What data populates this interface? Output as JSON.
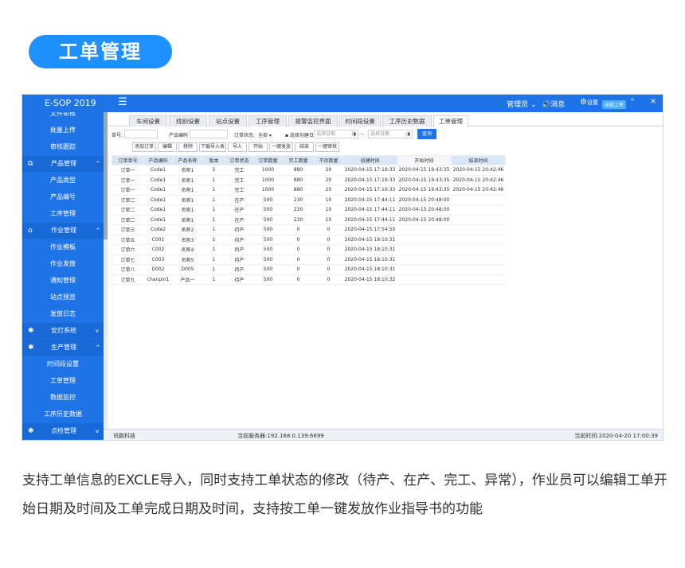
{
  "banner": {
    "title": "工单管理"
  },
  "topbar": {
    "brand": "E-SOP 2019",
    "menu_icon": "menu-icon",
    "user": "管理员",
    "messages": "消息",
    "settings": "设置",
    "badge": "当前上件",
    "minimize": "ᵒ",
    "close": "×"
  },
  "sidebar": {
    "items": [
      {
        "type": "item",
        "label": "文件审核",
        "icon": ""
      },
      {
        "type": "item",
        "label": "批量上传",
        "icon": ""
      },
      {
        "type": "item",
        "label": "审核跟踪",
        "icon": ""
      },
      {
        "type": "group",
        "label": "产品管理",
        "icon": "cube-icon",
        "arrow": "^"
      },
      {
        "type": "item",
        "label": "产品类型",
        "icon": ""
      },
      {
        "type": "item",
        "label": "产品编号",
        "icon": ""
      },
      {
        "type": "item",
        "label": "工序管理",
        "icon": ""
      },
      {
        "type": "group",
        "label": "作业管理",
        "icon": "factory-icon",
        "arrow": "^"
      },
      {
        "type": "item",
        "label": "作业模板",
        "icon": ""
      },
      {
        "type": "item",
        "label": "作业发放",
        "icon": ""
      },
      {
        "type": "item",
        "label": "通知管理",
        "icon": ""
      },
      {
        "type": "item",
        "label": "站点预览",
        "icon": ""
      },
      {
        "type": "item",
        "label": "发放日志",
        "icon": ""
      },
      {
        "type": "group",
        "label": "安灯系统",
        "icon": "bug-icon",
        "arrow": "v"
      },
      {
        "type": "group",
        "label": "生产管理",
        "icon": "bug-icon",
        "arrow": "^"
      },
      {
        "type": "item",
        "label": "时间段设置",
        "icon": ""
      },
      {
        "type": "item",
        "label": "工单管理",
        "icon": ""
      },
      {
        "type": "item",
        "label": "数据监控",
        "icon": ""
      },
      {
        "type": "item",
        "label": "工序历史数据",
        "icon": ""
      },
      {
        "type": "group",
        "label": "点检管理",
        "icon": "bug-icon",
        "arrow": "v"
      }
    ]
  },
  "tabs": [
    "车间设置",
    "线别设置",
    "站点设置",
    "工序管理",
    "报警监控界面",
    "时间段设置",
    "工序历史数据",
    "工单管理"
  ],
  "active_tab": 7,
  "filters": {
    "order_label": "单号:",
    "product_label": "产品编码",
    "status_label": "订单状态:",
    "status_value": "全部",
    "date_label": "选择创建日期",
    "date_start_placeholder": "选择日期",
    "date_sep": "--",
    "date_end_placeholder": "选择日期",
    "query": "查询"
  },
  "actions": [
    "添加订单",
    "编辑",
    "移除",
    "下载导入表",
    "导入",
    "开始",
    "一键发放",
    "结束",
    "一键审核"
  ],
  "table": {
    "columns": [
      "订单单号",
      "产品编码",
      "产品名称",
      "版本",
      "订单状态",
      "订单数量",
      "完工数量",
      "不良数量",
      "创建时间",
      "开始时间",
      "结束时间"
    ],
    "rows": [
      [
        "订单一",
        "Code1",
        "名称1",
        "1",
        "完工",
        "1000",
        "880",
        "20",
        "2020-04-15 17:19:33",
        "2020-04-15 19:43:35",
        "2020-04-15 20:42:46"
      ],
      [
        "订单一",
        "Code1",
        "名称1",
        "1",
        "完工",
        "1000",
        "880",
        "20",
        "2020-04-15 17:19:33",
        "2020-04-15 19:43:35",
        "2020-04-15 20:42:46"
      ],
      [
        "订单一",
        "Code1",
        "名称1",
        "1",
        "完工",
        "1000",
        "880",
        "20",
        "2020-04-15 17:19:33",
        "2020-04-15 19:43:35",
        "2020-04-15 20:42:46"
      ],
      [
        "订单二",
        "Code1",
        "名称1",
        "1",
        "在产",
        "500",
        "230",
        "10",
        "2020-04-15 17:44:11",
        "2020-04-15 20:48:00",
        ""
      ],
      [
        "订单二",
        "Code1",
        "名称1",
        "1",
        "在产",
        "500",
        "230",
        "10",
        "2020-04-15 17:44:11",
        "2020-04-15 20:48:00",
        ""
      ],
      [
        "订单二",
        "Code1",
        "名称1",
        "1",
        "在产",
        "500",
        "230",
        "10",
        "2020-04-15 17:44:11",
        "2020-04-15 20:48:00",
        ""
      ],
      [
        "订单三",
        "Code2",
        "名称2",
        "1",
        "待产",
        "500",
        "0",
        "0",
        "2020-04-15 17:54:50",
        "",
        ""
      ],
      [
        "订单五",
        "C001",
        "名称3",
        "1",
        "待产",
        "500",
        "0",
        "0",
        "2020-04-15 18:10:31",
        "",
        ""
      ],
      [
        "订单六",
        "C002",
        "名称4",
        "1",
        "待产",
        "500",
        "0",
        "0",
        "2020-04-15 18:10:31",
        "",
        ""
      ],
      [
        "订单七",
        "C003",
        "名称5",
        "1",
        "待产",
        "500",
        "0",
        "0",
        "2020-04-15 18:10:31",
        "",
        ""
      ],
      [
        "订单八",
        "D002",
        "D005",
        "1",
        "待产",
        "500",
        "0",
        "0",
        "2020-04-15 18:10:31",
        "",
        ""
      ],
      [
        "订单九",
        "chanpin1",
        "产品一",
        "1",
        "待产",
        "500",
        "0",
        "0",
        "2020-04-15 18:10:32",
        "",
        ""
      ]
    ]
  },
  "statusbar": {
    "company": "讯鹏科技",
    "server": "当前服务器:192.168.0.139:6699",
    "time": "当前时间:2020-04-20 17:00:39"
  },
  "description": "支持工单信息的EXCLE导入，同时支持工单状态的修改（待产、在产、完工、异常），作业员可以编辑工单开始日期及时间及工单完成日期及时间，支持按工单一键发放作业指导书的功能",
  "colors": {
    "primary": "#1E73E6",
    "banner": "#1E90FF",
    "header_row": "#D9E6F5"
  }
}
